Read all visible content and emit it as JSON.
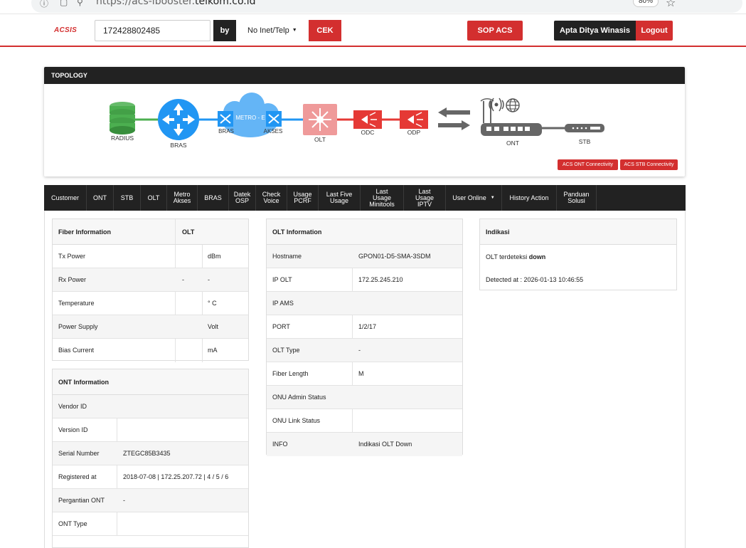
{
  "browser": {
    "url_prefix": "https://acs-ibooster.",
    "url_domain": "telkom.co.id",
    "zoom": "80%"
  },
  "header": {
    "logo": "ACSIS",
    "search_value": "172428802485",
    "by_label": "by",
    "type_select": "No Inet/Telp",
    "cek_label": "CEK",
    "sop_label": "SOP ACS",
    "user_name": "Apta Ditya Winasis",
    "logout_label": "Logout"
  },
  "topology": {
    "title": "TOPOLOGY",
    "nodes": {
      "radius": "RADIUS",
      "bras": "BRAS",
      "metro_center": "METRO - E",
      "metro_left": "BRAS",
      "metro_right": "AKSES",
      "olt": "OLT",
      "odc": "ODC",
      "odp": "ODP",
      "ont": "ONT",
      "stb": "STB"
    },
    "acs_ont_button": "ACS ONT Connectivity",
    "acs_stb_button": "ACS STB Connectivity",
    "colors": {
      "green": "#4caf50",
      "blue": "#2196f3",
      "red": "#e53935",
      "gray": "#666666",
      "cloud": "#64b5f6",
      "olt": "#ef9a9a"
    }
  },
  "tabs": [
    {
      "l1": "Customer",
      "l2": ""
    },
    {
      "l1": "ONT",
      "l2": ""
    },
    {
      "l1": "STB",
      "l2": ""
    },
    {
      "l1": "OLT",
      "l2": ""
    },
    {
      "l1": "Metro",
      "l2": "Akses"
    },
    {
      "l1": "BRAS",
      "l2": ""
    },
    {
      "l1": "Datek",
      "l2": "OSP"
    },
    {
      "l1": "Check",
      "l2": "Voice"
    },
    {
      "l1": "Usage",
      "l2": "PCRF"
    },
    {
      "l1": "Last Five",
      "l2": "Usage"
    },
    {
      "l1": "Last Usage",
      "l2": "Minitools"
    },
    {
      "l1": "Last Usage",
      "l2": "IPTV"
    },
    {
      "l1": "User Online",
      "l2": ""
    },
    {
      "l1": "History Action",
      "l2": ""
    },
    {
      "l1": "Panduan",
      "l2": "Solusi"
    }
  ],
  "fiber": {
    "title": "Fiber Information",
    "col2_title": "OLT",
    "rows": [
      {
        "label": "Tx Power",
        "value": "",
        "unit": "dBm"
      },
      {
        "label": "Rx Power",
        "value": "-",
        "unit": "-"
      },
      {
        "label": "Temperature",
        "value": "",
        "unit": "° C"
      },
      {
        "label": "Power Supply",
        "value": "",
        "unit": "Volt"
      },
      {
        "label": "Bias Current",
        "value": "",
        "unit": "mA"
      }
    ]
  },
  "ont_info": {
    "title": "ONT Information",
    "rows": [
      {
        "label": "Vendor ID",
        "value": ""
      },
      {
        "label": "Version ID",
        "value": ""
      },
      {
        "label": "Serial Number",
        "value": "ZTEGC85B3435"
      },
      {
        "label": "Registered at",
        "value": "2018-07-08 | 172.25.207.72 | 4 / 5 / 6"
      },
      {
        "label": "Pergantian ONT",
        "value": "-"
      },
      {
        "label": "ONT Type",
        "value": ""
      }
    ]
  },
  "olt_info": {
    "title": "OLT Information",
    "rows": [
      {
        "label": "Hostname",
        "value": "GPON01-D5-SMA-3SDM"
      },
      {
        "label": "IP OLT",
        "value": "172.25.245.210"
      },
      {
        "label": "IP AMS",
        "value": ""
      },
      {
        "label": "PORT",
        "value": "1/2/17"
      },
      {
        "label": "OLT Type",
        "value": "-"
      },
      {
        "label": "Fiber Length",
        "value": "M"
      },
      {
        "label": "ONU Admin Status",
        "value": ""
      },
      {
        "label": "ONU Link Status",
        "value": ""
      },
      {
        "label": "INFO",
        "value": "Indikasi OLT Down"
      }
    ]
  },
  "indikasi": {
    "title": "Indikasi",
    "status_prefix": "OLT terdeteksi",
    "status_word": "down",
    "detected": "Detected at : 2026-01-13 10:46:55"
  }
}
